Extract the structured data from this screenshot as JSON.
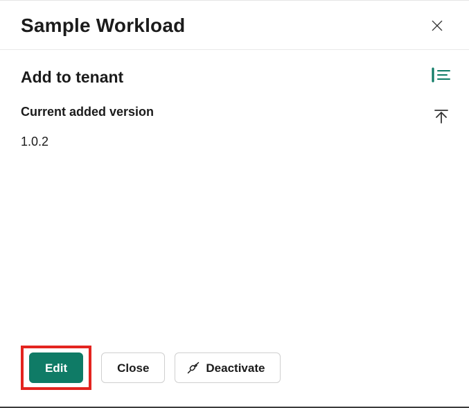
{
  "header": {
    "title": "Sample Workload",
    "close_icon": "close"
  },
  "section": {
    "title": "Add to tenant",
    "version_label": "Current added version",
    "version_value": "1.0.2"
  },
  "rail": {
    "list_view_icon": "list-settings",
    "scroll_top_icon": "scroll-to-top"
  },
  "footer": {
    "edit_label": "Edit",
    "close_label": "Close",
    "deactivate_label": "Deactivate",
    "deactivate_icon": "unplug"
  },
  "colors": {
    "accent": "#0f7b66",
    "highlight": "#e3241f"
  }
}
